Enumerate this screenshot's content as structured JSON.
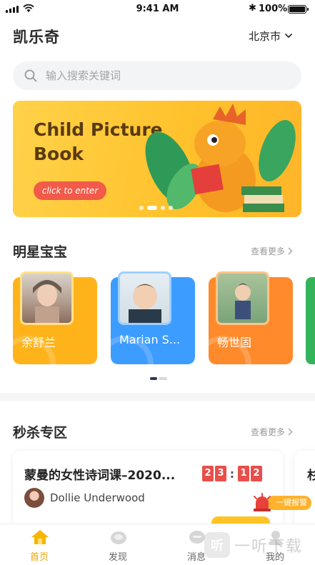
{
  "status_bar": {
    "time": "9:41 AM",
    "battery": "100%"
  },
  "header": {
    "app_title": "凯乐奇",
    "city": "北京市"
  },
  "search": {
    "placeholder": "输入搜索关键词"
  },
  "banner": {
    "title_line1": "Child Picture",
    "title_line2": "Book",
    "cta": "click to enter",
    "slides": 4,
    "active_slide": 2
  },
  "stars": {
    "title": "明星宝宝",
    "see_more": "查看更多",
    "cards": [
      {
        "name": "余舒兰",
        "color": "#ffb31a"
      },
      {
        "name": "Marian S...",
        "color": "#3d9cff"
      },
      {
        "name": "畅世固",
        "color": "#ff8a2b"
      }
    ]
  },
  "flash_sale": {
    "title": "秒杀专区",
    "see_more": "查看更多",
    "item": {
      "course": "蒙曼的女性诗词课–2020...",
      "timer": [
        "2",
        "3",
        "1",
        "2"
      ],
      "author": "Dollie Underwood"
    },
    "next_item_prefix": "杉"
  },
  "alarm": {
    "label": "一键报警"
  },
  "tabs": [
    {
      "label": "首页",
      "active": true
    },
    {
      "label": "发现",
      "active": false
    },
    {
      "label": "消息",
      "active": false
    },
    {
      "label": "我的",
      "active": false
    }
  ],
  "watermark": {
    "logo": "听",
    "text": "一听下载"
  },
  "colors": {
    "accent": "#ffc326",
    "active_tab": "#f0a300",
    "timer_red": "#e84f4b",
    "cta_red": "#f25a4a"
  }
}
